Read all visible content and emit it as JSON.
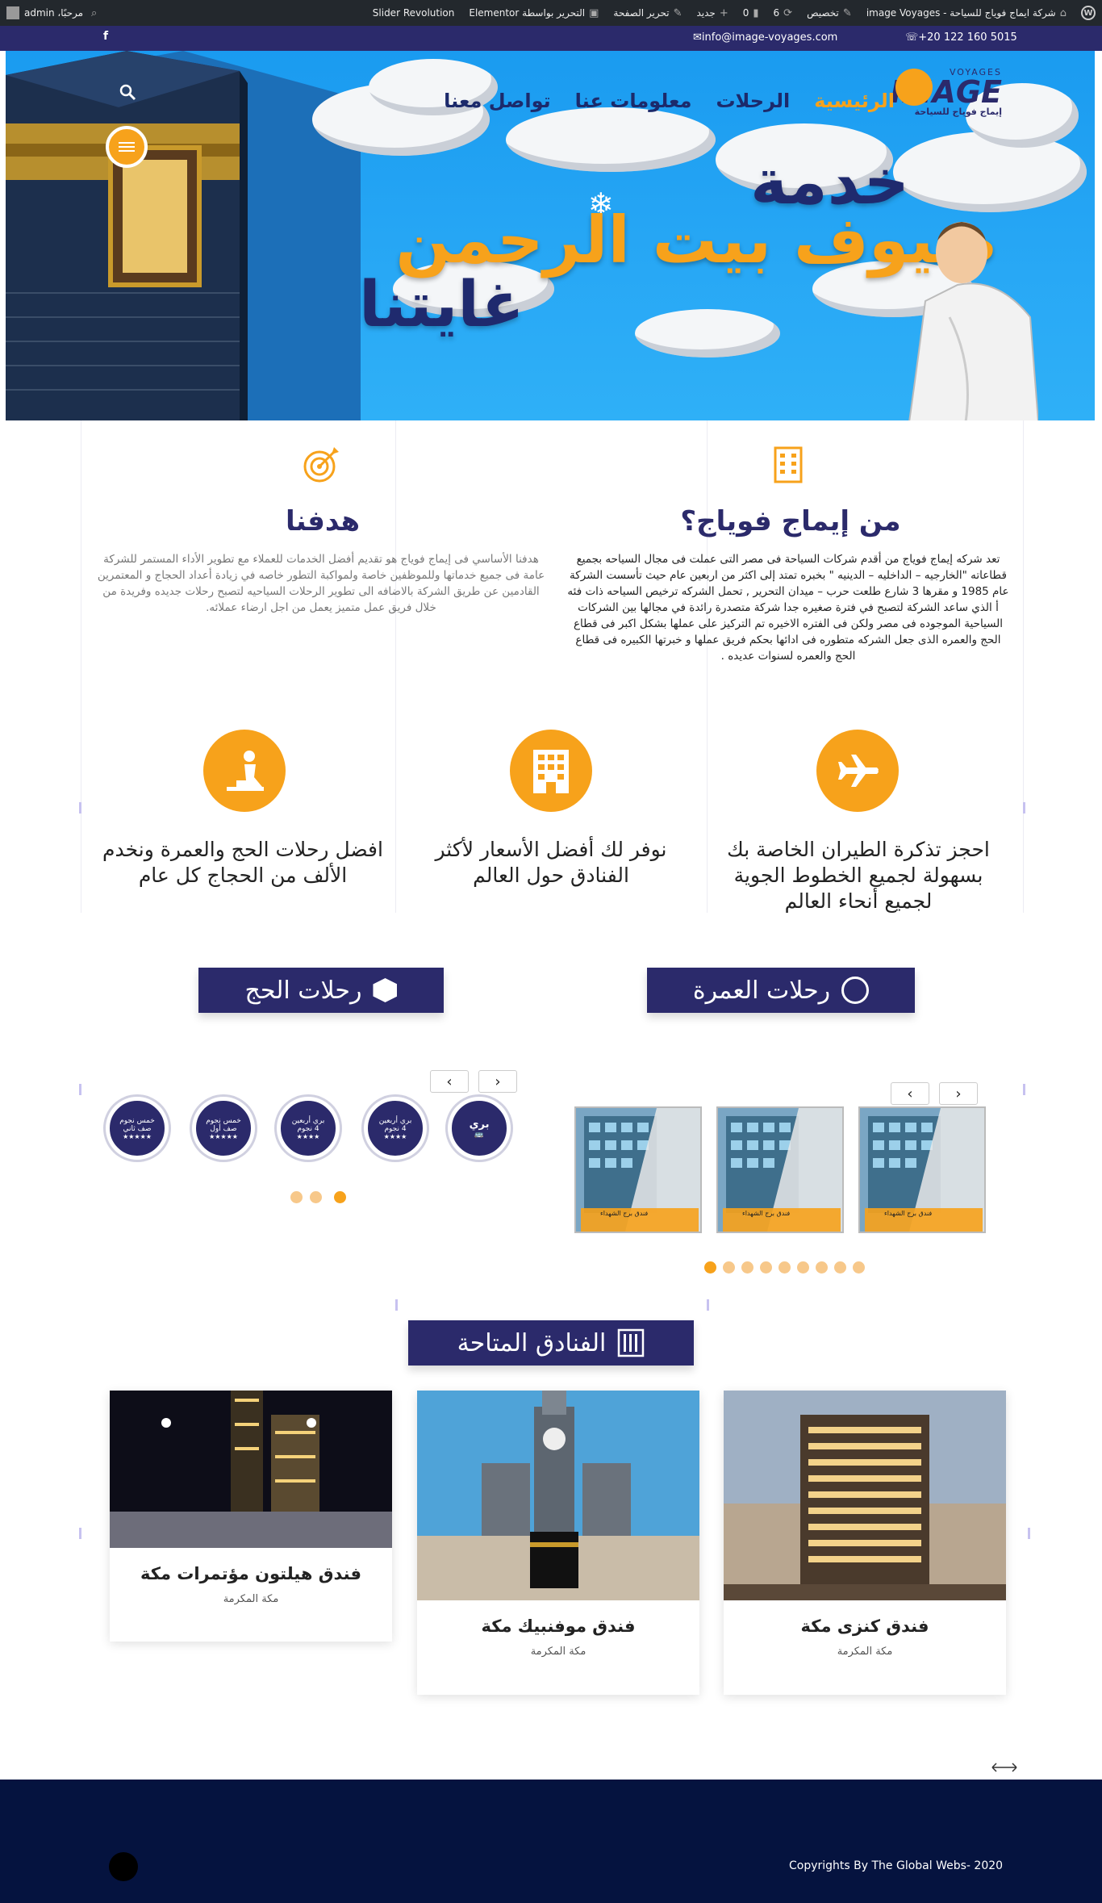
{
  "admin_bar": {
    "site_name": "شركة ايماج فوياج للسياحة - image Voyages",
    "customize": "تخصيص",
    "updates_count": "6",
    "comments_count": "0",
    "new": "جديد",
    "edit_page": "تحرير الصفحة",
    "edit_elementor": "التحرير بواسطة Elementor",
    "slider_revolution": "Slider Revolution",
    "greeting": "مرحبًا، admin"
  },
  "topbar": {
    "phone": "☏+20 122 160 5015",
    "email": "info@image-voyages.com",
    "facebook": "f"
  },
  "header": {
    "logo": {
      "top": "VOYAGES",
      "main": "IMAGE",
      "sub": "إيماج فوياج للسياحة"
    },
    "nav": [
      {
        "label": "الرئيسية",
        "active": true
      },
      {
        "label": "الرحلات",
        "active": false
      },
      {
        "label": "معلومات عنا",
        "active": false
      },
      {
        "label": "تواصل معنا",
        "active": false
      }
    ]
  },
  "hero": {
    "line1": "خدمة",
    "line2": "ضيوف بيت الرحمن",
    "line3": "غايتنا"
  },
  "about": {
    "title": "من إيماج فوياج؟",
    "text": "تعد شركه إيماج فوياج من أقدم شركات السياحة فى مصر التى عملت فى مجال السياحه بجميع قطاعاته \"الخارجيه – الداخليه – الدينيه \" بخبره تمتد إلى اكثر من اربعين عام حيث تأسست الشركة عام 1985 و مقرها 3 شارع طلعت حرب – ميدان التحرير , تحمل الشركه ترخيص السياحه ذات فئه أ الذي ساعد الشركة لتصبح في فترة صغيره جدا شركة متصدرة رائدة في مجالها بين الشركات السياحية الموجوده فى مصر ولكن فى الفتره الاخيره تم التركيز على عملها بشكل اكبر فى قطاع الحج والعمره الذى جعل الشركه متطوره فى ادائها بحكم فريق عملها و خبرتها الكبيره فى قطاع الحج والعمره لسنوات عديده ."
  },
  "goal": {
    "title": "هدفنا",
    "text": "هدفنا الأساسي فى إيماج فوياج هو تقديم أفضل الخدمات للعملاء مع تطوير الأداء المستمر للشركة عامة فى جميع خدماتها وللموظفين خاصة ولمواكبة التطور خاصه في زيادة أعداد الحجاج و المعتمرين القادمين عن طريق الشركة بالاضافه الى تطوير الرحلات السياحيه لتصبح رحلات جديده وفريدة من خلال فريق عمل متميز يعمل من اجل ارضاء عملائه."
  },
  "features": [
    {
      "icon": "airplane-icon",
      "text": "احجز تذكرة الطيران الخاصة بك بسهولة لجميع الخطوط الجوية لجميع أنحاء العالم"
    },
    {
      "icon": "hotel-icon",
      "text": "نوفر لك أفضل الأسعار لأكثر الفنادق حول العالم"
    },
    {
      "icon": "praying-icon",
      "text": "افضل رحلات الحج والعمرة ونخدم الألف من الحجاج كل عام"
    }
  ],
  "umrah": {
    "title": "رحلات العمرة",
    "cards": [
      {
        "caption": "فندق برج الشهداء"
      },
      {
        "caption": "فندق برج الشهداء"
      },
      {
        "caption": "فندق برج الشهداء"
      }
    ],
    "dots": 9,
    "active_dot": 9
  },
  "hajj": {
    "title": "رحلات الحج",
    "badges": [
      {
        "line1": "بري",
        "line2": "🚌"
      },
      {
        "line1": "بري أربعين",
        "line2": "4 نجوم"
      },
      {
        "line1": "بري أربعين",
        "line2": "4 نجوم"
      },
      {
        "line1": "خمس نجوم",
        "line2": "صف أول"
      },
      {
        "line1": "خمس نجوم",
        "line2": "صف ثاني"
      }
    ],
    "dots": 3,
    "active_dot": 1
  },
  "hotels": {
    "title": "الفنادق المتاحة",
    "items": [
      {
        "name": "فندق كنزى مكة",
        "location": "مكة المكرمة"
      },
      {
        "name": "فندق موفنبيك مكة",
        "location": "مكة المكرمة"
      },
      {
        "name": "فندق هيلتون مؤتمرات مكة",
        "location": "مكة المكرمة"
      }
    ]
  },
  "footer": {
    "copyright": "Copyrights By The Global Webs- 2020"
  },
  "colors": {
    "primary": "#2b2a6b",
    "accent": "#f7a21b",
    "footer": "#05133f",
    "admin_bar": "#23282d"
  }
}
